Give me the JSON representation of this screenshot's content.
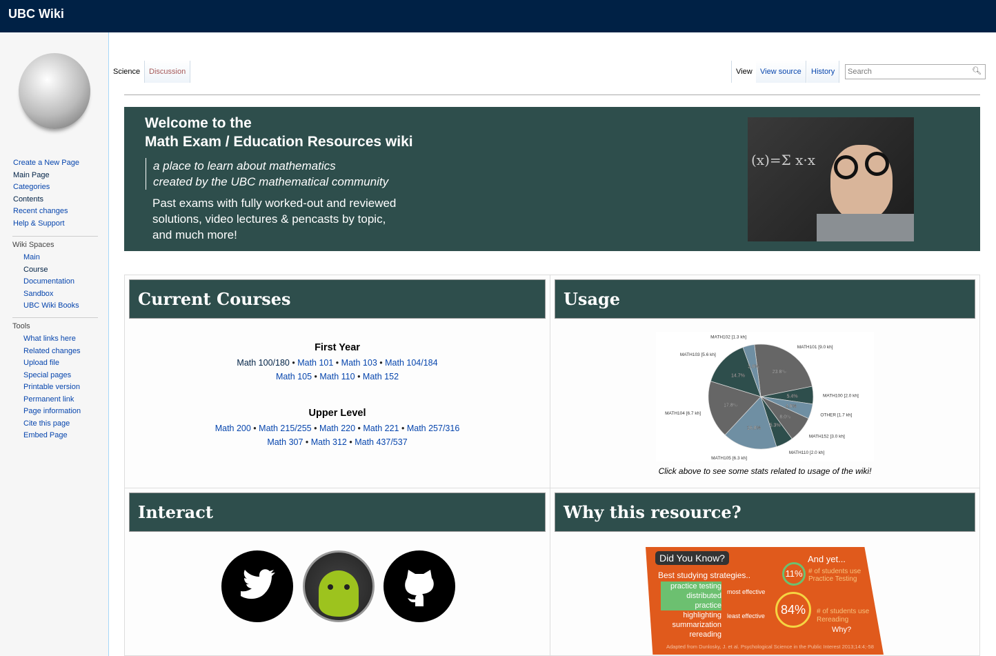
{
  "header": {
    "title": "UBC Wiki"
  },
  "sidebar": {
    "nav": [
      "Create a New Page",
      "Main Page",
      "Categories",
      "Contents",
      "Recent changes",
      "Help & Support"
    ],
    "wiki_spaces": {
      "heading": "Wiki Spaces",
      "items": [
        "Main",
        "Course",
        "Documentation",
        "Sandbox",
        "UBC Wiki Books"
      ]
    },
    "tools": {
      "heading": "Tools",
      "items": [
        "What links here",
        "Related changes",
        "Upload file",
        "Special pages",
        "Printable version",
        "Permanent link",
        "Page information",
        "Cite this page",
        "Embed Page"
      ]
    }
  },
  "tabs": {
    "left": [
      "Science",
      "Discussion"
    ],
    "right": [
      "View",
      "View source",
      "History"
    ],
    "search_placeholder": "Search"
  },
  "banner": {
    "title1": "Welcome to the",
    "title2": "Math Exam / Education Resources wiki",
    "tag1": "a place to learn about mathematics",
    "tag2": "created by the UBC mathematical community",
    "desc1": "Past exams with fully worked-out and reviewed",
    "desc2": "solutions, video lectures & pencasts by topic,",
    "desc3": "and much more!"
  },
  "courses": {
    "title": "Current Courses",
    "first_year": {
      "heading": "First Year",
      "row1": [
        "Math 100/180",
        "Math 101",
        "Math 103",
        "Math 104/184"
      ],
      "row2": [
        "Math 105",
        "Math 110",
        "Math 152"
      ]
    },
    "upper": {
      "heading": "Upper Level",
      "row1": [
        "Math 200",
        "Math 215/255",
        "Math 220",
        "Math 221",
        "Math 257/316"
      ],
      "row2": [
        "Math 307",
        "Math 312",
        "Math 437/537"
      ]
    }
  },
  "usage": {
    "title": "Usage",
    "caption": "Click above to see some stats related to usage of the wiki!",
    "pie": {
      "type": "pie",
      "slices": [
        {
          "label": "MATH101 [9.0 kh]",
          "pct": "23.8%",
          "value": 23.8,
          "color": "#666666"
        },
        {
          "label": "MATH100 [2.0 kh]",
          "pct": "5.4%",
          "value": 5.4,
          "color": "#2e4e4c"
        },
        {
          "label": "OTHER [1.7 kh]",
          "pct": "4.6%",
          "value": 4.6,
          "color": "#6f8fa3"
        },
        {
          "label": "MATH152 [3.0 kh]",
          "pct": "8.0%",
          "value": 8.0,
          "color": "#666666"
        },
        {
          "label": "MATH110 [2.0 kh]",
          "pct": "5.3%",
          "value": 5.3,
          "color": "#2e4e4c"
        },
        {
          "label": "MATH105 [6.3 kh]",
          "pct": "16.8%",
          "value": 16.8,
          "color": "#6f8fa3"
        },
        {
          "label": "MATH104 [6.7 kh]",
          "pct": "17.8%",
          "value": 17.8,
          "color": "#666666"
        },
        {
          "label": "MATH103 [5.6 kh]",
          "pct": "14.7%",
          "value": 14.7,
          "color": "#2e4e4c"
        },
        {
          "label": "MATH102 [1.3 kh]",
          "pct": "3.6%",
          "value": 3.6,
          "color": "#6f8fa3"
        }
      ]
    }
  },
  "interact": {
    "title": "Interact",
    "icons": [
      "twitter-icon",
      "android-icon",
      "github-icon"
    ]
  },
  "why": {
    "title": "Why this resource?",
    "infographic": {
      "heading": "Did You Know?",
      "subheading": "Best studying strategies..",
      "strategies": [
        "practice testing",
        "distributed practice",
        "highlighting",
        "summarization",
        "rereading"
      ],
      "most": "most effective",
      "least": "least effective",
      "andyet": "And yet...",
      "stat1": "11%",
      "stat1_text": "# of students use Practice Testing",
      "stat2": "84%",
      "stat2_text": "# of students use Rereading",
      "why": "Why?",
      "source": "Adapted from Dunlosky, J. et al. Psychological Science in the Public Interest 2013;14:4;-58"
    }
  }
}
